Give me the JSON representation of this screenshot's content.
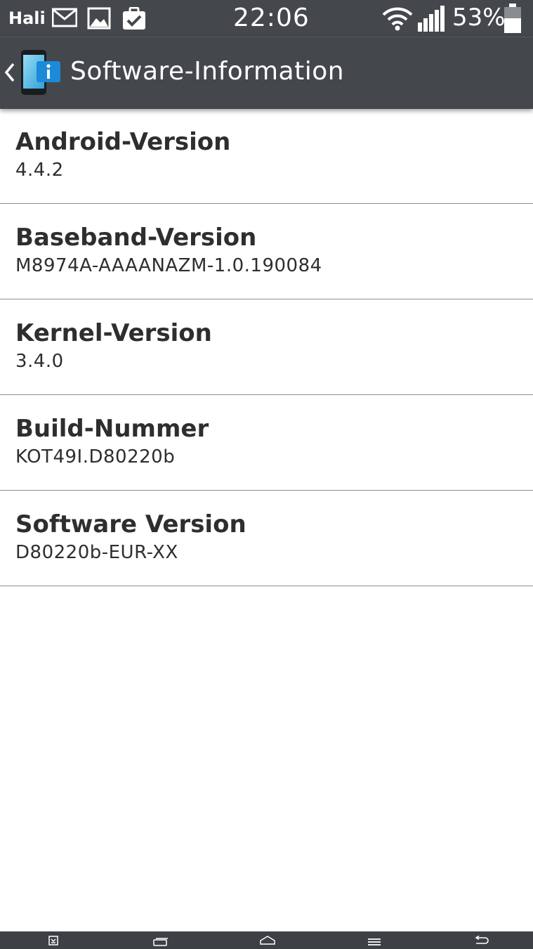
{
  "status_bar": {
    "carrier": "Hali",
    "time": "22:06",
    "battery_percent": "53%",
    "icons": [
      "gmail-icon",
      "gallery-icon",
      "clipboard-check-icon",
      "wifi-icon",
      "signal-icon",
      "battery-icon"
    ]
  },
  "action_bar": {
    "title": "Software-Information",
    "icon": "phone-info-icon"
  },
  "items": [
    {
      "title": "Android-Version",
      "value": "4.4.2"
    },
    {
      "title": "Baseband-Version",
      "value": "M8974A-AAAANAZM-1.0.190084"
    },
    {
      "title": "Kernel-Version",
      "value": "3.4.0"
    },
    {
      "title": "Build-Nummer",
      "value": "KOT49I.D80220b"
    },
    {
      "title": "Software Version",
      "value": "D80220b-EUR-XX"
    }
  ],
  "nav_bar": {
    "buttons": [
      "notification-tray-icon",
      "dual-window-icon",
      "home-icon",
      "menu-icon",
      "back-icon"
    ]
  },
  "colors": {
    "bar_background": "#44484c",
    "text": "#2e2e2e",
    "divider": "#8c8f92",
    "accent_blue": "#1c8ad8"
  }
}
